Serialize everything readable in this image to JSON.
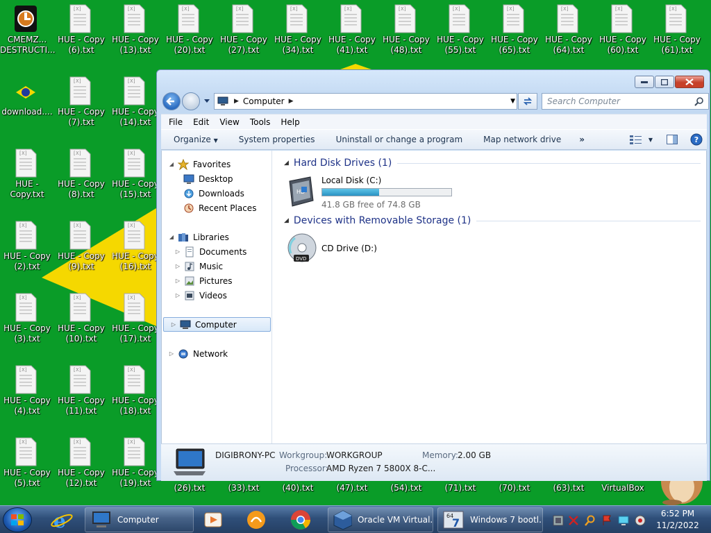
{
  "desktop": {
    "icons": [
      {
        "label": "CMEMZ... DESTRUCTI...",
        "type": "app"
      },
      {
        "label": "HUE - Copy (6).txt"
      },
      {
        "label": "HUE - Copy (13).txt"
      },
      {
        "label": "HUE - Copy (20).txt"
      },
      {
        "label": "HUE - Copy (27).txt"
      },
      {
        "label": "HUE - Copy (34).txt"
      },
      {
        "label": "HUE - Copy (41).txt"
      },
      {
        "label": "HUE - Copy (48).txt"
      },
      {
        "label": "HUE - Copy (55).txt"
      },
      {
        "label": "HUE - Copy (65).txt"
      },
      {
        "label": "HUE - Copy (64).txt"
      },
      {
        "label": "HUE - Copy (60).txt"
      },
      {
        "label": "HUE - Copy (61).txt"
      },
      {
        "label": "download....",
        "type": "flag"
      },
      {
        "label": "HUE - Copy (7).txt"
      },
      {
        "label": "HUE - Copy (14).txt"
      },
      {
        "label": "HUE - Copy.txt"
      },
      {
        "label": "HUE - Copy (8).txt"
      },
      {
        "label": "HUE - Copy (15).txt"
      },
      {
        "label": "HUE - Copy (2).txt"
      },
      {
        "label": "HUE - Copy (9).txt"
      },
      {
        "label": "HUE - Copy (16).txt"
      },
      {
        "label": "HUE - Copy (3).txt"
      },
      {
        "label": "HUE - Copy (10).txt"
      },
      {
        "label": "HUE - Copy (17).txt"
      },
      {
        "label": "HUE - Copy (4).txt"
      },
      {
        "label": "HUE - Copy (11).txt"
      },
      {
        "label": "HUE - Copy (18).txt"
      },
      {
        "label": "HUE - Copy (5).txt"
      },
      {
        "label": "HUE - Copy (12).txt"
      },
      {
        "label": "HUE - Copy (19).txt"
      }
    ],
    "bottom_labels": [
      "(26).txt",
      "(33).txt",
      "(40).txt",
      "(47).txt",
      "(54).txt",
      "(71).txt",
      "(70).txt",
      "(63).txt",
      "VirtualBox"
    ]
  },
  "window": {
    "address": {
      "crumb": "Computer"
    },
    "search_placeholder": "Search Computer",
    "menu": [
      "File",
      "Edit",
      "View",
      "Tools",
      "Help"
    ],
    "commands": [
      "Organize",
      "System properties",
      "Uninstall or change a program",
      "Map network drive"
    ],
    "more": "»",
    "nav": {
      "favorites": "Favorites",
      "desktop": "Desktop",
      "downloads": "Downloads",
      "recent": "Recent Places",
      "libraries": "Libraries",
      "documents": "Documents",
      "music": "Music",
      "pictures": "Pictures",
      "videos": "Videos",
      "computer": "Computer",
      "network": "Network"
    },
    "groups": {
      "hdd": "Hard Disk Drives (1)",
      "removable": "Devices with Removable Storage (1)"
    },
    "drives": {
      "c": {
        "name": "Local Disk (C:)",
        "free": "41.8 GB free of 74.8 GB",
        "used_fraction": 0.441
      },
      "d": {
        "name": "CD Drive (D:)"
      }
    },
    "details": {
      "computer_name": "DIGIBRONY-PC",
      "workgroup_label": "Workgroup:",
      "workgroup": "WORKGROUP",
      "memory_label": "Memory:",
      "memory": "2.00 GB",
      "processor_label": "Processor:",
      "processor": "AMD Ryzen 7 5800X 8-C..."
    }
  },
  "taskbar": {
    "computer": "Computer",
    "vbox": "Oracle VM Virtual...",
    "win7": "Windows 7 bootl...",
    "time": "6:52 PM",
    "date": "11/2/2022"
  },
  "colors": {
    "desktop": "#0a9c28",
    "accent_yellow": "#f5d800",
    "bar_fill": "#2a93c2"
  }
}
